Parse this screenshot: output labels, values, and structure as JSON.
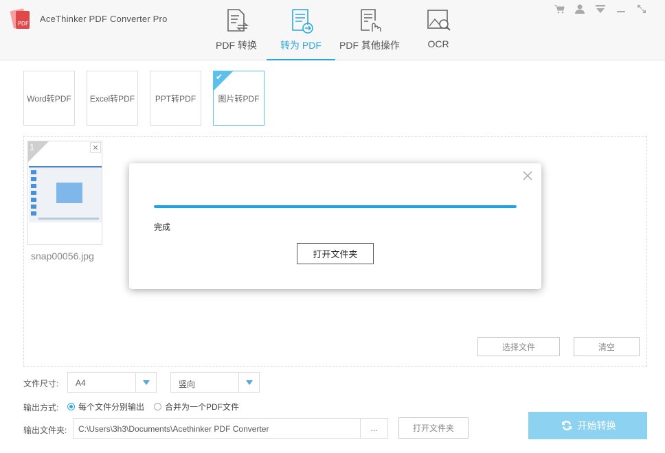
{
  "app": {
    "title": "AceThinker PDF Converter Pro",
    "logo_text": "PDF"
  },
  "nav": {
    "tabs": [
      {
        "label": "PDF 转换",
        "icon": "pdf-convert-icon"
      },
      {
        "label": "转为 PDF",
        "icon": "to-pdf-icon",
        "active": true
      },
      {
        "label": "PDF 其他操作",
        "icon": "pdf-tools-icon"
      },
      {
        "label": "OCR",
        "icon": "ocr-icon"
      }
    ]
  },
  "window_controls": [
    "cart-icon",
    "user-icon",
    "menu-icon",
    "minimize-icon",
    "maximize-icon"
  ],
  "subtabs": [
    {
      "label": "Word转PDF"
    },
    {
      "label": "Excel转PDF"
    },
    {
      "label": "PPT转PDF"
    },
    {
      "label": "图片转PDF",
      "active": true
    }
  ],
  "files": [
    {
      "index": "1",
      "name": "snap00056.jpg"
    }
  ],
  "dropzone": {
    "select_label": "选择文件",
    "clear_label": "清空"
  },
  "form": {
    "size_label": "文件尺寸:",
    "size_value": "A4",
    "orientation_value": "竖向",
    "output_mode_label": "输出方式:",
    "mode_separate": "每个文件分别输出",
    "mode_merge": "合并为一个PDF文件",
    "output_folder_label": "输出文件夹:",
    "output_path": "C:\\Users\\3h3\\Documents\\Acethinker PDF Converter",
    "browse_label": "...",
    "open_folder_label": "打开文件夹",
    "start_label": "开始转换"
  },
  "modal": {
    "progress": 1.0,
    "status": "完成",
    "open_folder_label": "打开文件夹"
  },
  "colors": {
    "accent": "#2aa7e0",
    "progress": "#19a6e8",
    "start_button": "#8dd3f1"
  }
}
